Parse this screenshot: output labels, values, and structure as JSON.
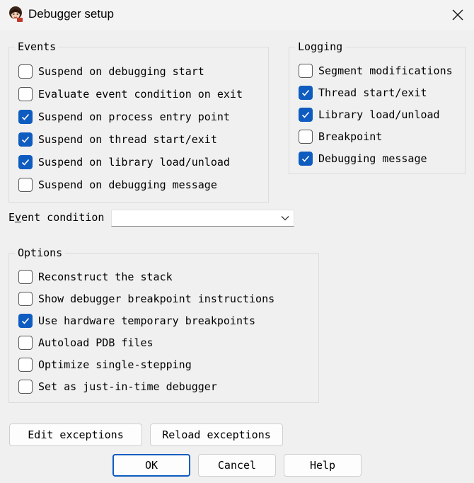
{
  "window": {
    "title": "Debugger setup",
    "icon": "app-avatar-icon",
    "close_icon": "close-icon"
  },
  "events": {
    "legend": "Events",
    "items": [
      {
        "label": "Suspend on debugging start",
        "checked": false
      },
      {
        "label": "Evaluate event condition on exit",
        "checked": false
      },
      {
        "label": "Suspend on process entry point",
        "checked": true
      },
      {
        "label": "Suspend on thread start/exit",
        "checked": true
      },
      {
        "label": "Suspend on library load/unload",
        "checked": true
      },
      {
        "label": "Suspend on debugging message",
        "checked": false
      }
    ]
  },
  "logging": {
    "legend": "Logging",
    "items": [
      {
        "label": "Segment modifications",
        "checked": false
      },
      {
        "label": "Thread start/exit",
        "checked": true
      },
      {
        "label": "Library load/unload",
        "checked": true
      },
      {
        "label": "Breakpoint",
        "checked": false
      },
      {
        "label": "Debugging message",
        "checked": true
      }
    ]
  },
  "event_condition": {
    "label_pre": "E",
    "label_accel": "v",
    "label_post": "ent condition",
    "value": ""
  },
  "options": {
    "legend": "Options",
    "items": [
      {
        "label": "Reconstruct the stack",
        "checked": false
      },
      {
        "label": "Show debugger breakpoint instructions",
        "checked": false
      },
      {
        "label": "Use hardware temporary breakpoints",
        "checked": true
      },
      {
        "label": "Autoload PDB files",
        "checked": false
      },
      {
        "label": "Optimize single-stepping",
        "checked": false
      },
      {
        "label": "Set as just-in-time debugger",
        "checked": false
      }
    ]
  },
  "buttons": {
    "edit_exceptions": "Edit exceptions",
    "reload_exceptions": "Reload exceptions",
    "ok": "OK",
    "cancel": "Cancel",
    "help": "Help"
  },
  "colors": {
    "accent": "#0f5cc0",
    "background": "#f0f0f0"
  }
}
